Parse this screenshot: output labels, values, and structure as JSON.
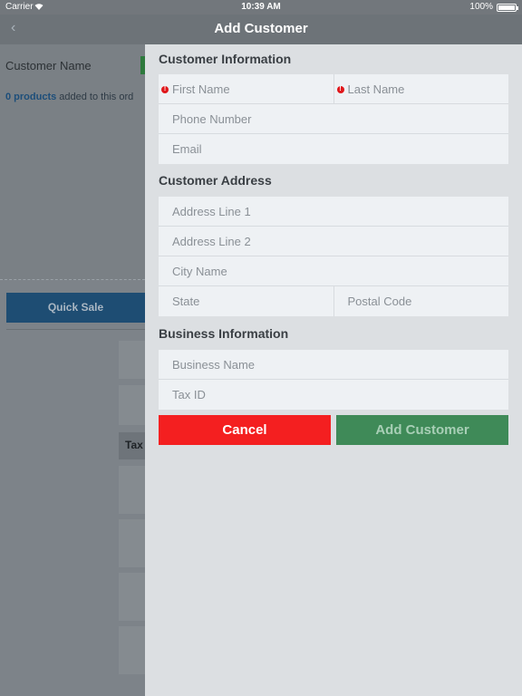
{
  "status_bar": {
    "carrier": "Carrier",
    "time": "10:39 AM",
    "battery": "100%"
  },
  "nav": {
    "back_icon": "chevron-left-icon",
    "title": "Add Customer"
  },
  "background": {
    "customer_label": "Customer Name",
    "products_count": "0 products",
    "products_suffix": " added to this ord",
    "quick_sale_label": "Quick Sale",
    "tax_label": "Tax"
  },
  "form": {
    "customer_info": {
      "title": "Customer Information",
      "first_name_placeholder": "First Name",
      "last_name_placeholder": "Last Name",
      "phone_placeholder": "Phone Number",
      "email_placeholder": "Email"
    },
    "address": {
      "title": "Customer Address",
      "line1_placeholder": "Address Line 1",
      "line2_placeholder": "Address Line 2",
      "city_placeholder": "City Name",
      "state_placeholder": "State",
      "postal_placeholder": "Postal Code"
    },
    "business": {
      "title": "Business Information",
      "name_placeholder": "Business Name",
      "tax_id_placeholder": "Tax ID"
    },
    "cancel_label": "Cancel",
    "submit_label": "Add Customer"
  },
  "colors": {
    "required": "#e0171b",
    "cancel": "#f41f20",
    "submit": "#3f8a58"
  }
}
